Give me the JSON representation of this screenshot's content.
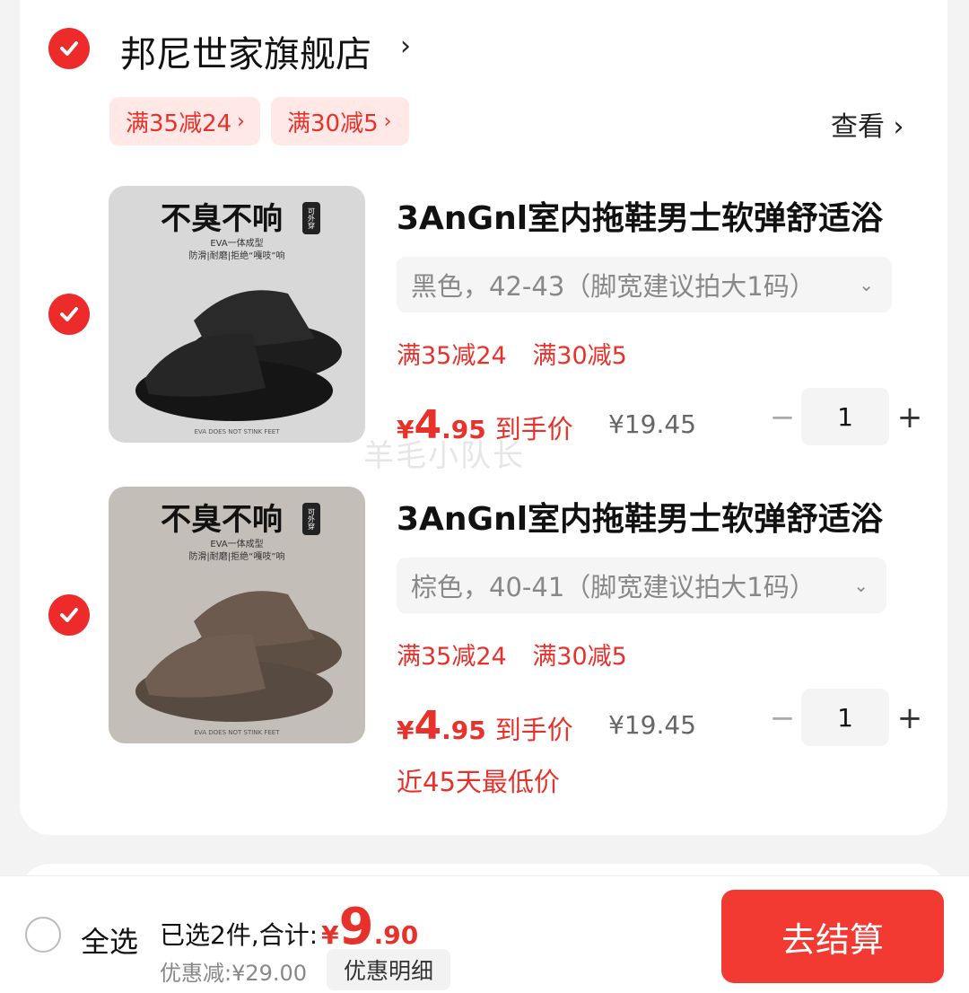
{
  "shop": {
    "name": "邦尼世家旗舰店",
    "arrow": "›",
    "promos": [
      {
        "label": "满35减24",
        "chevron": "›"
      },
      {
        "label": "满30减5",
        "chevron": "›"
      }
    ],
    "view_label": "查看 ›"
  },
  "items": [
    {
      "title": "3AnGnl室内拖鞋男士软弹舒适浴",
      "sku": "黑色，42-43（脚宽建议拍大1码）",
      "sku_caret": "⌄",
      "promos": [
        "满35减24",
        "满30减5"
      ],
      "price_yen": "¥",
      "price_int": "4",
      "price_dec": ".95",
      "price_label": "到手价",
      "original_price": "¥19.45",
      "qty_minus": "−",
      "quantity": "1",
      "qty_plus": "+",
      "image": {
        "headline": "不臭不响",
        "badge": "可外穿",
        "sub1": "EVA一体成型",
        "sub2": "防滑|耐磨|拒绝“嘎吱”响",
        "footer": "EVA DOES NOT STINK FEET",
        "shoe_color": "#1d1d1d",
        "bg_color": "#d8d8d8"
      }
    },
    {
      "title": "3AnGnl室内拖鞋男士软弹舒适浴",
      "sku": "棕色，40-41（脚宽建议拍大1码）",
      "sku_caret": "⌄",
      "promos": [
        "满35减24",
        "满30减5"
      ],
      "price_yen": "¥",
      "price_int": "4",
      "price_dec": ".95",
      "price_label": "到手价",
      "original_price": "¥19.45",
      "qty_minus": "−",
      "quantity": "1",
      "qty_plus": "+",
      "lowest_note": "近45天最低价",
      "image": {
        "headline": "不臭不响",
        "badge": "可外穿",
        "sub1": "EVA一体成型",
        "sub2": "防滑|耐磨|拒绝“嘎吱”响",
        "footer": "EVA DOES NOT STINK FEET",
        "shoe_color": "#6b5a4d",
        "bg_color": "#c4beb8"
      }
    }
  ],
  "watermark": "羊毛小队长",
  "footer": {
    "select_all": "全选",
    "summary_text": "已选2件,合计:",
    "total_yen": "¥",
    "total_int": "9",
    "total_dec": ".90",
    "discount": "优惠减:¥29.00",
    "detail_button": "优惠明细",
    "checkout_button": "去结算"
  },
  "colors": {
    "accent": "#ee2b2b",
    "price": "#e8312a",
    "promo_bg": "#ffe8e6",
    "checkout": "#f23a33"
  }
}
